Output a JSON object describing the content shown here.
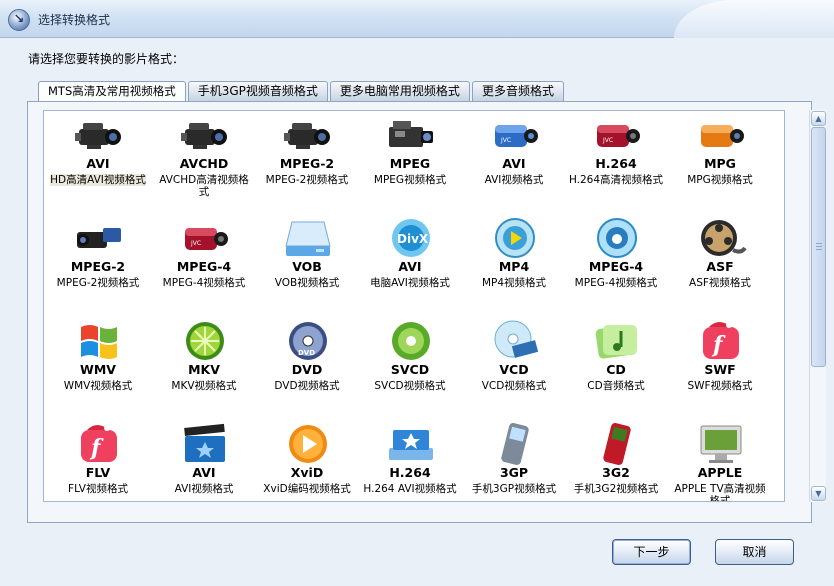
{
  "window": {
    "title": "选择转换格式"
  },
  "prompt": "请选择您要转换的影片格式：",
  "tabs": [
    {
      "label": "MTS高清及常用视频格式",
      "active": true
    },
    {
      "label": "手机3GP视频音频格式",
      "active": false
    },
    {
      "label": "更多电脑常用视频格式",
      "active": false
    },
    {
      "label": "更多音频格式",
      "active": false
    }
  ],
  "formats": [
    {
      "label": "AVI",
      "caption": "HD高清AVI视频格式",
      "icon": "camcorder-pro-icon",
      "selected": true
    },
    {
      "label": "AVCHD",
      "caption": "AVCHD高清视频格式",
      "icon": "camcorder-pro-icon",
      "selected": false
    },
    {
      "label": "MPEG-2",
      "caption": "MPEG-2视频格式",
      "icon": "camcorder-pro-icon",
      "selected": false
    },
    {
      "label": "MPEG",
      "caption": "MPEG视频格式",
      "icon": "broadcast-camera-icon",
      "selected": false
    },
    {
      "label": "AVI",
      "caption": "AVI视频格式",
      "icon": "blue-camcorder-icon",
      "selected": false
    },
    {
      "label": "H.264",
      "caption": "H.264高清视频格式",
      "icon": "red-camcorder-icon",
      "selected": false
    },
    {
      "label": "MPG",
      "caption": "MPG视频格式",
      "icon": "orange-camcorder-icon",
      "selected": false
    },
    {
      "label": "MPEG-2",
      "caption": "MPEG-2视频格式",
      "icon": "handycam-icon",
      "selected": false
    },
    {
      "label": "MPEG-4",
      "caption": "MPEG-4视频格式",
      "icon": "red-camcorder-icon",
      "selected": false
    },
    {
      "label": "VOB",
      "caption": "VOB视频格式",
      "icon": "drive-icon",
      "selected": false
    },
    {
      "label": "AVI",
      "caption": "电脑AVI视频格式",
      "icon": "divx-icon",
      "selected": false
    },
    {
      "label": "MP4",
      "caption": "MP4视频格式",
      "icon": "play-disc-icon",
      "selected": false
    },
    {
      "label": "MPEG-4",
      "caption": "MPEG-4视频格式",
      "icon": "apple-disc-icon",
      "selected": false
    },
    {
      "label": "ASF",
      "caption": "ASF视频格式",
      "icon": "film-reel-icon",
      "selected": false
    },
    {
      "label": "WMV",
      "caption": "WMV视频格式",
      "icon": "windows-flag-icon",
      "selected": false
    },
    {
      "label": "MKV",
      "caption": "MKV视频格式",
      "icon": "lime-icon",
      "selected": false
    },
    {
      "label": "DVD",
      "caption": "DVD视频格式",
      "icon": "dvd-disc-icon",
      "selected": false
    },
    {
      "label": "SVCD",
      "caption": "SVCD视频格式",
      "icon": "green-disc-icon",
      "selected": false
    },
    {
      "label": "VCD",
      "caption": "VCD视频格式",
      "icon": "vcd-disc-icon",
      "selected": false
    },
    {
      "label": "CD",
      "caption": "CD音频格式",
      "icon": "music-note-icon",
      "selected": false
    },
    {
      "label": "SWF",
      "caption": "SWF视频格式",
      "icon": "flash-icon",
      "selected": false
    },
    {
      "label": "FLV",
      "caption": "FLV视频格式",
      "icon": "flash-icon",
      "selected": false
    },
    {
      "label": "AVI",
      "caption": "AVI视频格式",
      "icon": "clapperboard-icon",
      "selected": false
    },
    {
      "label": "XviD",
      "caption": "XviD编码视频格式",
      "icon": "xvid-play-icon",
      "selected": false
    },
    {
      "label": "H.264",
      "caption": "H.264 AVI视频格式",
      "icon": "star-tray-icon",
      "selected": false
    },
    {
      "label": "3GP",
      "caption": "手机3GP视频格式",
      "icon": "mobile-phone-icon",
      "selected": false
    },
    {
      "label": "3G2",
      "caption": "手机3G2视频格式",
      "icon": "red-phone-icon",
      "selected": false
    },
    {
      "label": "APPLE",
      "caption": "APPLE TV高清视频格式",
      "icon": "monitor-icon",
      "selected": false
    }
  ],
  "scrollbar": {
    "up": "▲",
    "down": "▼"
  },
  "buttons": {
    "next": "下一步",
    "cancel": "取消"
  }
}
